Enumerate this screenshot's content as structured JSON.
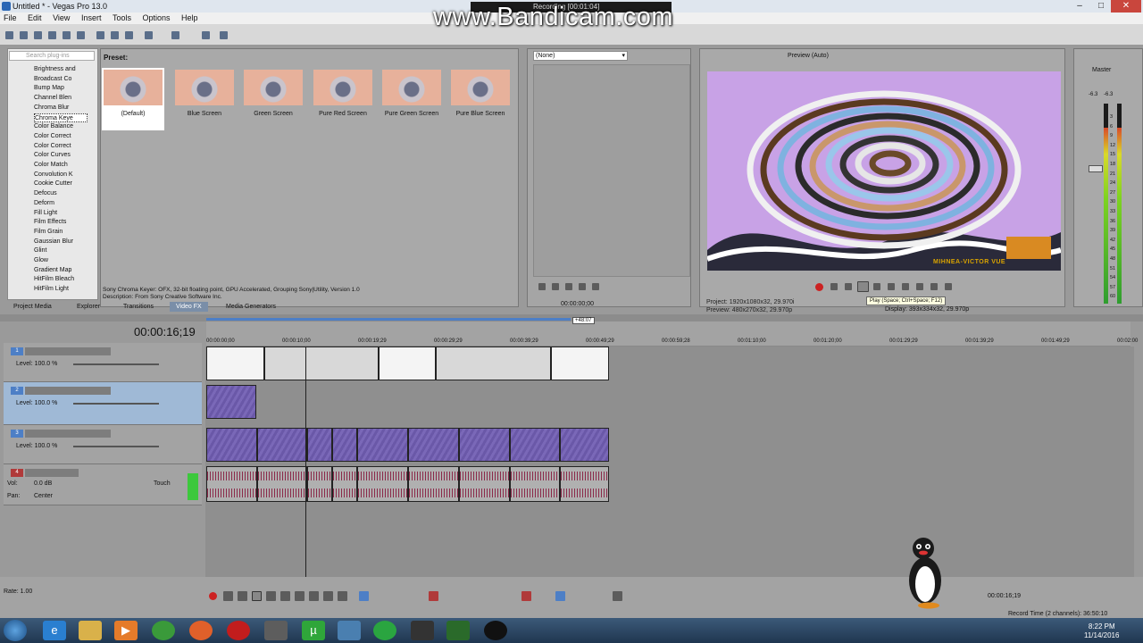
{
  "window": {
    "title": "Untitled * - Vegas Pro 13.0"
  },
  "menu": [
    "File",
    "Edit",
    "View",
    "Insert",
    "Tools",
    "Options",
    "Help"
  ],
  "overlay": {
    "watermark": "www.Bandicam.com",
    "recording": "Recording [00:01:04]"
  },
  "explorer": {
    "search_placeholder": "Search plug-ins",
    "items": [
      "Brightness and",
      "Broadcast Co",
      "Bump Map",
      "Channel Blen",
      "Chroma Blur",
      "Chroma Keye",
      "Color Balance",
      "Color Correct",
      "Color Correct",
      "Color Curves",
      "Color Match",
      "Convolution K",
      "Cookie Cutter",
      "Defocus",
      "Deform",
      "Fill Light",
      "Film Effects",
      "Film Grain",
      "Gaussian Blur",
      "Glint",
      "Glow",
      "Gradient Map",
      "HitFilm Bleach",
      "HitFilm Light"
    ],
    "selected_index": 5
  },
  "presets": {
    "label": "Preset:",
    "items": [
      "(Default)",
      "Blue Screen",
      "Green Screen",
      "Pure Red Screen",
      "Pure Green Screen",
      "Pure Blue Screen"
    ],
    "description_line1": "Sony Chroma Keyer: OFX, 32-bit floating point, GPU Accelerated, Grouping Sony|Utility, Version 1.0",
    "description_line2": "Description: From Sony Creative Software Inc."
  },
  "tabs": [
    "Project Media",
    "Explorer",
    "Transitions",
    "Video FX",
    "Media Generators"
  ],
  "active_tab": "Video FX",
  "trimmer": {
    "dropdown": "(None)",
    "time": "00:00:00;00"
  },
  "preview": {
    "mode": "Preview (Auto)",
    "overlay_text": "MIHNEA-VICTOR VUE",
    "project": "1920x1080x32, 29.970i",
    "preview_res": "480x270x32, 29.970p",
    "display": "393x334x32, 29.970p",
    "project_label": "Project:",
    "preview_label": "Preview:",
    "display_label": "Display:",
    "tooltip": "Play (Space; Ctrl+Space; F12)"
  },
  "master": {
    "label": "Master",
    "left": "-6.3",
    "right": "-6.3",
    "scale": [
      "3",
      "6",
      "9",
      "12",
      "15",
      "18",
      "21",
      "24",
      "27",
      "30",
      "33",
      "36",
      "39",
      "42",
      "45",
      "48",
      "51",
      "54",
      "57",
      "60"
    ]
  },
  "timeline": {
    "timecode": "00:00:16;19",
    "length_badge": "+48:07",
    "ruler": [
      "00:00:00;00",
      "00:00:10;00",
      "00:00:19;29",
      "00:00:29;29",
      "00:00:39;29",
      "00:00:49;29",
      "00:00:59;28",
      "00:01:10;00",
      "00:01:20;00",
      "00:01:29;29",
      "00:01:39;29",
      "00:01:49;29",
      "00:02:00"
    ],
    "tracks": [
      {
        "num": "1",
        "level": "Level: 100.0 %"
      },
      {
        "num": "2",
        "level": "Level: 100.0 %"
      },
      {
        "num": "3",
        "level": "Level: 100.0 %"
      },
      {
        "num": "4",
        "vol": "Vol:",
        "vol_value": "0.0 dB",
        "pan": "Pan:",
        "pan_value": "Center",
        "touch": "Touch"
      }
    ],
    "rate": "Rate: 1.00",
    "bottom_tc": "00:00:16;19",
    "record_time": "Record Time (2 channels): 36:50:10"
  },
  "taskbar": {
    "time": "8:22 PM",
    "date": "11/14/2016"
  },
  "colors": {
    "selected_track": "#9fb9d6",
    "clip_purple": "#6a58a8",
    "panel_bg": "#a9a9a9"
  }
}
